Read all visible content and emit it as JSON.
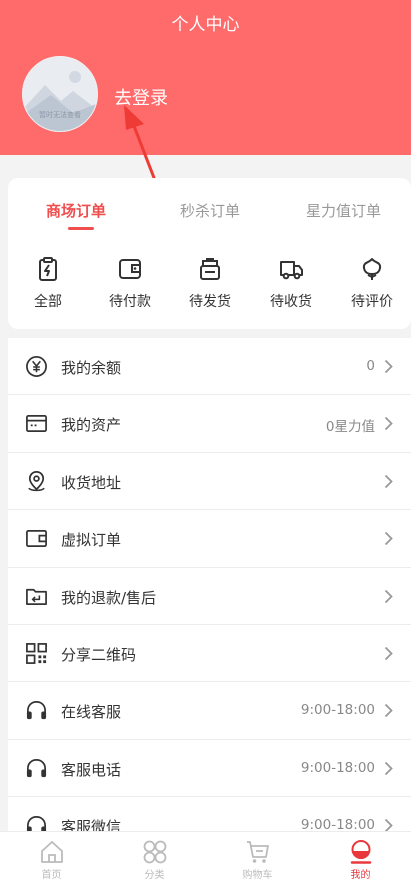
{
  "header": {
    "title": "个人中心",
    "login_label": "去登录",
    "avatar_caption": "暂时无法查看"
  },
  "order_tabs": [
    "商场订单",
    "秒杀订单",
    "星力值订单"
  ],
  "order_statuses": [
    {
      "label": "全部",
      "icon": "clipboard-icon"
    },
    {
      "label": "待付款",
      "icon": "wallet-icon"
    },
    {
      "label": "待发货",
      "icon": "package-icon"
    },
    {
      "label": "待收货",
      "icon": "truck-icon"
    },
    {
      "label": "待评价",
      "icon": "flower-icon"
    }
  ],
  "menu": [
    {
      "label": "我的余额",
      "value": "0",
      "icon": "yuan-icon"
    },
    {
      "label": "我的资产",
      "value": "0星力值",
      "icon": "card-icon"
    },
    {
      "label": "收货地址",
      "value": "",
      "icon": "location-icon"
    },
    {
      "label": "虚拟订单",
      "value": "",
      "icon": "wallet-icon"
    },
    {
      "label": "我的退款/售后",
      "value": "",
      "icon": "return-folder-icon"
    },
    {
      "label": "分享二维码",
      "value": "",
      "icon": "qrcode-icon"
    },
    {
      "label": "在线客服",
      "value": "9:00-18:00",
      "icon": "headset-icon"
    },
    {
      "label": "客服电话",
      "value": "9:00-18:00",
      "icon": "headset-icon"
    },
    {
      "label": "客服微信",
      "value": "9:00-18:00",
      "icon": "headset-icon"
    }
  ],
  "tabbar": [
    {
      "label": "首页",
      "icon": "home-icon"
    },
    {
      "label": "分类",
      "icon": "category-icon"
    },
    {
      "label": "购物车",
      "icon": "cart-icon"
    },
    {
      "label": "我的",
      "icon": "profile-icon"
    }
  ],
  "colors": {
    "brand": "#ff6a6b",
    "accent": "#f04e4e",
    "tab_active": "#e9383b"
  }
}
